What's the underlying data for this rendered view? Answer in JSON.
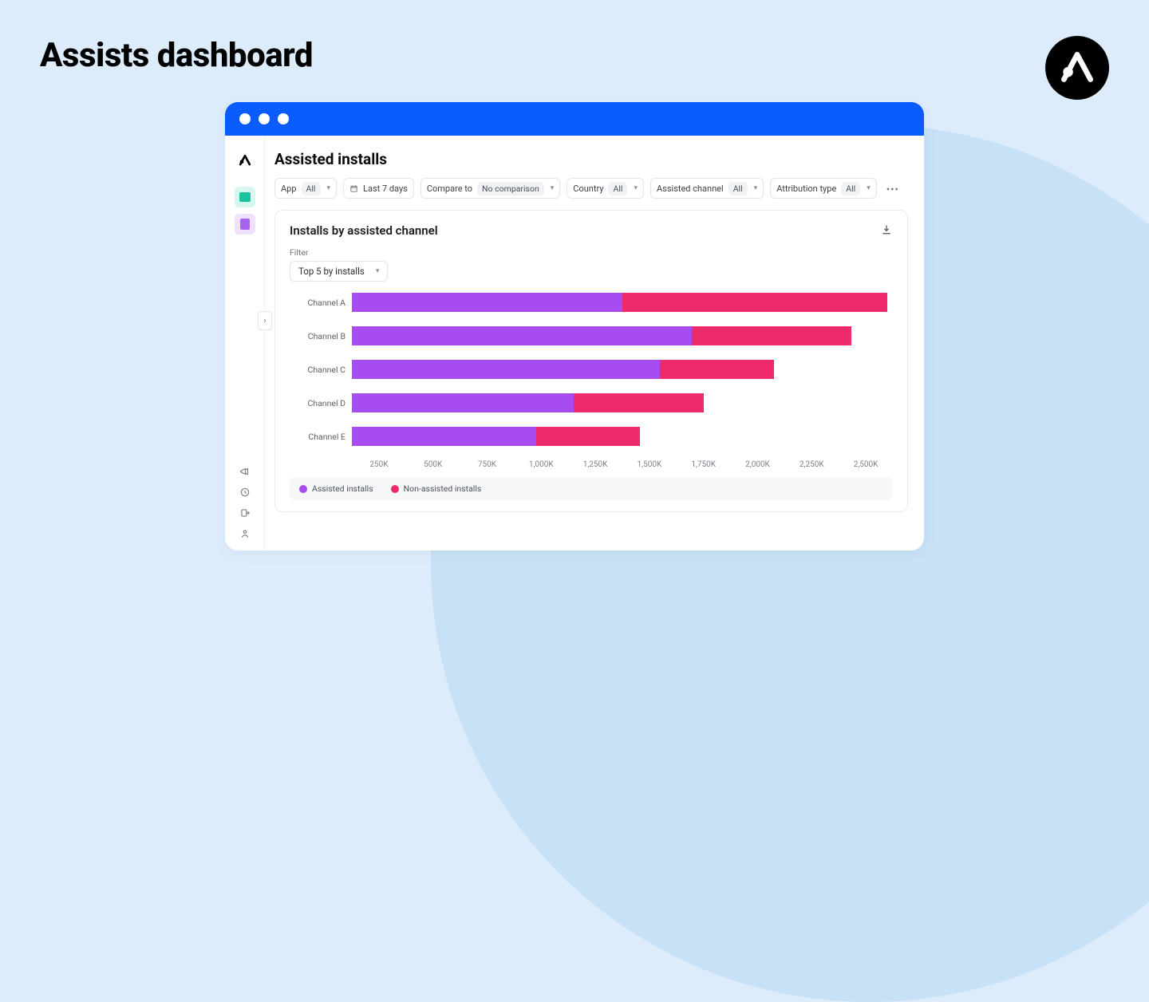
{
  "page": {
    "title": "Assists dashboard"
  },
  "header": {
    "title": "Assisted installs"
  },
  "filters": {
    "app_label": "App",
    "app_value": "All",
    "date_label": "Last 7 days",
    "compare_label": "Compare to",
    "compare_value": "No comparison",
    "country_label": "Country",
    "country_value": "All",
    "assisted_channel_label": "Assisted channel",
    "assisted_channel_value": "All",
    "attribution_label": "Attribution type",
    "attribution_value": "All"
  },
  "card": {
    "title": "Installs by assisted channel",
    "filter_label": "Filter",
    "filter_value": "Top 5 by installs"
  },
  "legend": {
    "assisted": "Assisted installs",
    "non_assisted": "Non-assisted installs"
  },
  "axis_ticks": [
    "250K",
    "500K",
    "750K",
    "1,000K",
    "1,250K",
    "1,500K",
    "1,750K",
    "2,000K",
    "2,250K",
    "2,500K"
  ],
  "chart_data": {
    "type": "bar",
    "orientation": "horizontal",
    "stacked": true,
    "title": "Installs by assisted channel",
    "xlabel": "",
    "ylabel": "",
    "xlim": [
      0,
      2500
    ],
    "x_unit": "K",
    "categories": [
      "Channel A",
      "Channel B",
      "Channel C",
      "Channel D",
      "Channel E"
    ],
    "series": [
      {
        "name": "Assisted installs",
        "color": "#a64cf0",
        "values": [
          1250,
          1570,
          1425,
          1025,
          850
        ]
      },
      {
        "name": "Non-assisted installs",
        "color": "#ef2a6a",
        "values": [
          1225,
          740,
          525,
          600,
          480
        ]
      }
    ],
    "legend_position": "bottom",
    "grid": false
  }
}
